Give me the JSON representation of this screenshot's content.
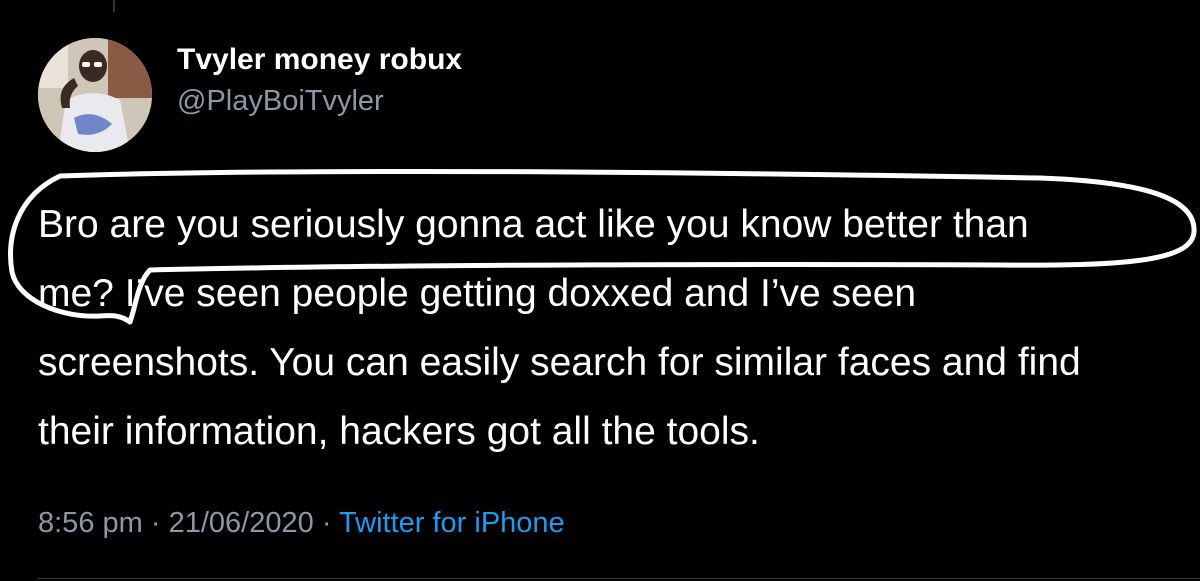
{
  "tweet": {
    "author": {
      "display_name": "Tvyler money robux",
      "handle": "@PlayBoiTvyler"
    },
    "text_lines": [
      "Bro are you seriously gonna act like you know better than",
      "me? I’ve seen people getting doxxed and I’ve seen",
      "screenshots. You can easily search for similar faces and find",
      "their information, hackers got all the tools."
    ],
    "time": "8:56 pm",
    "separator": "·",
    "date": "21/06/2020",
    "source": "Twitter for iPhone"
  },
  "colors": {
    "background": "#000000",
    "text": "#ffffff",
    "secondary_text": "#8b98a5",
    "link": "#1d9bf0",
    "annotation": "#ffffff"
  },
  "icons": {
    "avatar": "profile-photo"
  }
}
